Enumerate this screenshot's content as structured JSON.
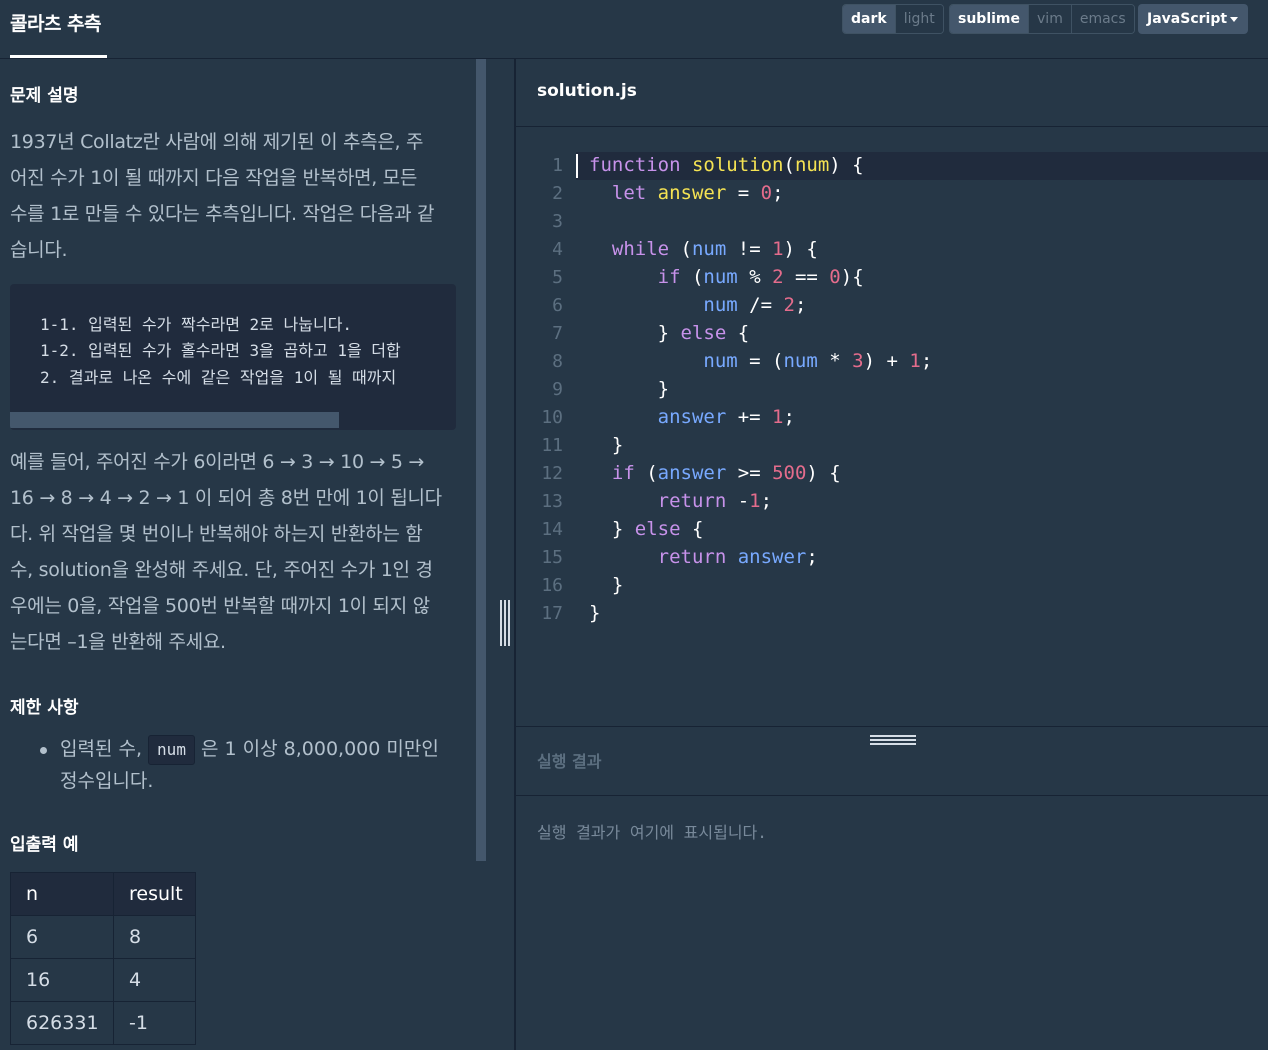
{
  "header": {
    "title": "콜라츠 추측",
    "theme_options": [
      "dark",
      "light"
    ],
    "theme_selected": "dark",
    "keymap_options": [
      "sublime",
      "vim",
      "emacs"
    ],
    "keymap_selected": "sublime",
    "language": "JavaScript"
  },
  "problem": {
    "section_title": "문제 설명",
    "intro_lines": [
      "1937년 Collatz란 사람에 의해 제기된 이 추측은, 주",
      "어진 수가 1이 될 때까지 다음 작업을 반복하면, 모든",
      "수를 1로 만들 수 있다는 추측입니다. 작업은 다음과 같",
      "습니다."
    ],
    "steps": [
      "1-1. 입력된 수가 짝수라면 2로 나눕니다.",
      "1-2. 입력된 수가 홀수라면 3을 곱하고 1을 더합",
      "2. 결과로 나온 수에 같은 작업을 1이 될 때까지"
    ],
    "example_lines": [
      "예를 들어, 주어진 수가 6이라면 6 → 3 → 10 → 5 →",
      "16 → 8 → 4 → 2 → 1 이 되어 총 8번 만에 1이 됩니다",
      "다. 위 작업을 몇 번이나 반복해야 하는지 반환하는 함",
      "수, solution을 완성해 주세요. 단, 주어진 수가 1인 경",
      "우에는 0을, 작업을 500번 반복할 때까지 1이 되지 않",
      "는다면 –1을 반환해 주세요."
    ]
  },
  "constraints": {
    "section_title": "제한 사항",
    "item_prefix": "입력된 수, ",
    "item_code": "num",
    "item_suffix": " 은 1 이상 8,000,000 미만인 정수입니다."
  },
  "io_examples": {
    "section_title": "입출력 예",
    "headers": [
      "n",
      "result"
    ],
    "rows": [
      [
        "6",
        "8"
      ],
      [
        "16",
        "4"
      ],
      [
        "626331",
        "-1"
      ]
    ]
  },
  "editor": {
    "filename": "solution.js",
    "line_numbers": [
      "1",
      "2",
      "3",
      "4",
      "5",
      "6",
      "7",
      "8",
      "9",
      "10",
      "11",
      "12",
      "13",
      "14",
      "15",
      "16",
      "17"
    ]
  },
  "result": {
    "title": "실행 결과",
    "placeholder": "실행 결과가 여기에 표시됩니다."
  },
  "colors": {
    "background": "#263747",
    "code_background": "#202b3d",
    "keyword": "#c792ea",
    "function_name": "#f5e353",
    "variable": "#78a9ff",
    "number": "#e46c8c"
  }
}
